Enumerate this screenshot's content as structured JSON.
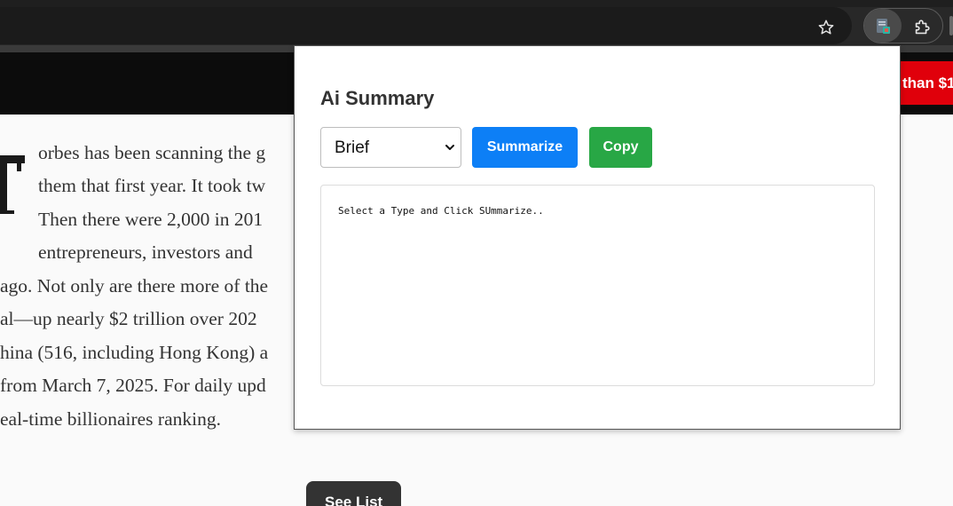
{
  "browser": {
    "icons": {
      "bookmark": "star-icon",
      "extension_active": "summary-extension-icon",
      "extensions_menu": "puzzle-icon"
    }
  },
  "site": {
    "header_cta_text": "than $1"
  },
  "article": {
    "lines": [
      "orbes has been scanning the g",
      "them that first year. It took tw",
      "Then there were 2,000 in 201",
      "entrepreneurs, investors and",
      "ago. Not only are there more of the",
      "al—up nearly $2 trillion over 202",
      "hina (516, including Hong Kong) a",
      "from March 7, 2025. For daily upd",
      "eal-time billionaires ranking."
    ],
    "see_list_label": "See List"
  },
  "popup": {
    "title": "Ai Summary",
    "select_value": "Brief",
    "summarize_label": "Summarize",
    "copy_label": "Copy",
    "result_text": "Select a Type and Click SUmmarize..",
    "colors": {
      "summarize": "#0d7ff6",
      "copy": "#28a745"
    }
  }
}
